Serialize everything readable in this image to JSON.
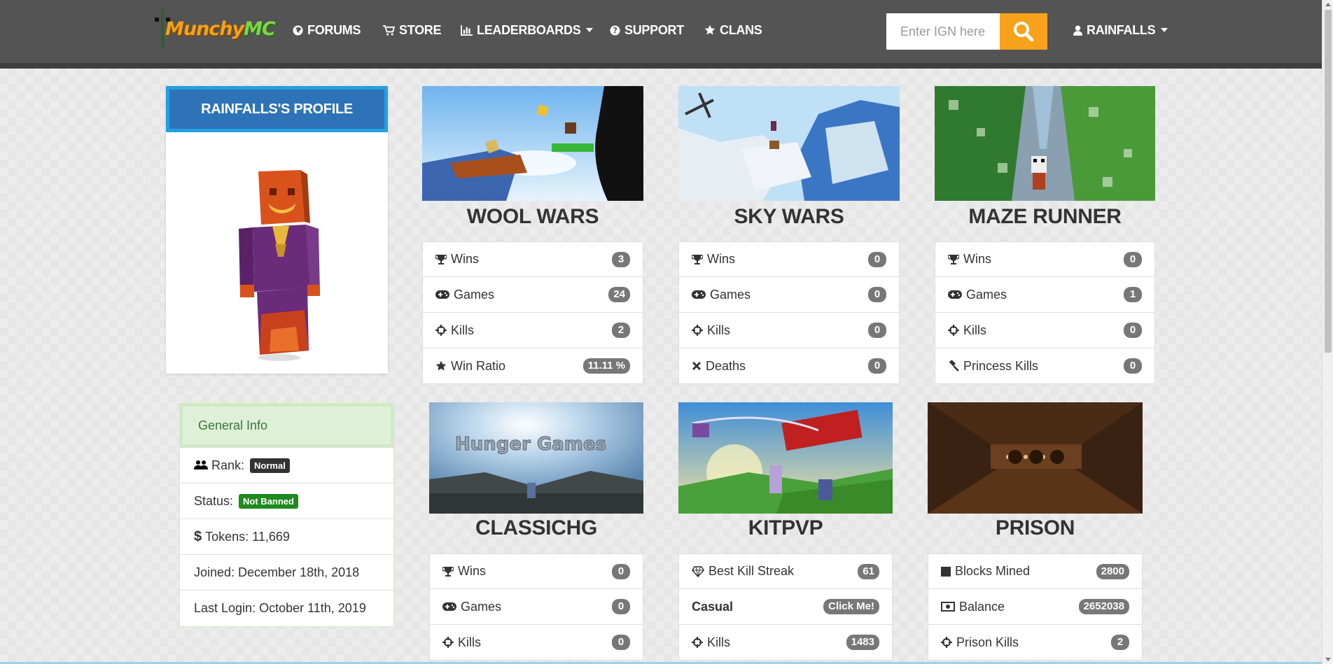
{
  "navbar": {
    "logo_text": "MunchyMC",
    "items": [
      {
        "label": "FORUMS",
        "icon": "globe-icon"
      },
      {
        "label": "STORE",
        "icon": "cart-icon"
      },
      {
        "label": "LEADERBOARDS",
        "icon": "bar-chart-icon"
      },
      {
        "label": "SUPPORT",
        "icon": "question-circle-icon"
      },
      {
        "label": "CLANS",
        "icon": "star-icon"
      }
    ],
    "search_placeholder": "Enter IGN here",
    "user": "RAINFALLS"
  },
  "profile": {
    "title": "RAINFALLS'S PROFILE"
  },
  "general_info": {
    "heading": "General Info",
    "rank_label": "Rank:",
    "rank_value": "Normal",
    "status_label": "Status:",
    "status_value": "Not Banned",
    "tokens": "Tokens: 11,669",
    "joined": "Joined: December 18th, 2018",
    "last_login": "Last Login: October 11th, 2019",
    "colors": {
      "rank_badge": "#333333",
      "status_badge": "#1e8a1e"
    }
  },
  "games": [
    {
      "title": "WOOL WARS",
      "stats": [
        {
          "label": "Wins",
          "value": "3",
          "icon": "trophy-icon"
        },
        {
          "label": "Games",
          "value": "24",
          "icon": "gamepad-icon"
        },
        {
          "label": "Kills",
          "value": "2",
          "icon": "crosshairs-icon"
        },
        {
          "label": "Win Ratio",
          "value": "11.11 %",
          "icon": "star-icon"
        }
      ]
    },
    {
      "title": "SKY WARS",
      "stats": [
        {
          "label": "Wins",
          "value": "0",
          "icon": "trophy-icon"
        },
        {
          "label": "Games",
          "value": "0",
          "icon": "gamepad-icon"
        },
        {
          "label": "Kills",
          "value": "0",
          "icon": "crosshairs-icon"
        },
        {
          "label": "Deaths",
          "value": "0",
          "icon": "times-icon"
        }
      ]
    },
    {
      "title": "MAZE RUNNER",
      "stats": [
        {
          "label": "Wins",
          "value": "0",
          "icon": "trophy-icon"
        },
        {
          "label": "Games",
          "value": "1",
          "icon": "gamepad-icon"
        },
        {
          "label": "Kills",
          "value": "0",
          "icon": "crosshairs-icon"
        },
        {
          "label": "Princess Kills",
          "value": "0",
          "icon": "gavel-icon"
        }
      ]
    },
    {
      "title": "CLASSICHG",
      "image_text": "Hunger Games",
      "stats": [
        {
          "label": "Wins",
          "value": "0",
          "icon": "trophy-icon"
        },
        {
          "label": "Games",
          "value": "0",
          "icon": "gamepad-icon"
        },
        {
          "label": "Kills",
          "value": "0",
          "icon": "crosshairs-icon"
        }
      ]
    },
    {
      "title": "KITPVP",
      "stats": [
        {
          "label": "Best Kill Streak",
          "value": "61",
          "icon": "diamond-icon"
        },
        {
          "label": "Casual",
          "value": "Click Me!",
          "icon": ""
        },
        {
          "label": "Kills",
          "value": "1483",
          "icon": "crosshairs-icon"
        }
      ]
    },
    {
      "title": "PRISON",
      "stats": [
        {
          "label": "Blocks Mined",
          "value": "2800",
          "icon": "square-icon"
        },
        {
          "label": "Balance",
          "value": "2652038",
          "icon": "money-icon"
        },
        {
          "label": "Prison Kills",
          "value": "2",
          "icon": "crosshairs-icon"
        }
      ]
    }
  ],
  "colors": {
    "navbar": "#545454",
    "accent": "#f7a21b",
    "profile_header": "#2e73b8",
    "badge": "#777777"
  }
}
